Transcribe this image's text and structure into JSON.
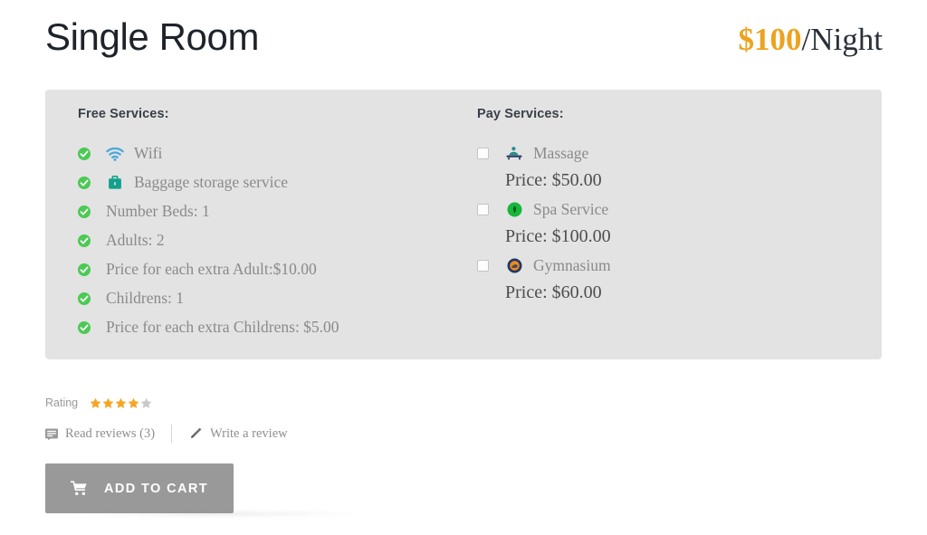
{
  "header": {
    "room_title": "Single Room",
    "price_amount": "$100",
    "price_unit": "/Night"
  },
  "panel": {
    "free_heading": "Free Services:",
    "pay_heading": "Pay Services:",
    "free_services": [
      {
        "label": "Wifi",
        "icon": "wifi-icon",
        "check": "check-circle-icon"
      },
      {
        "label": "Baggage storage service",
        "icon": "briefcase-icon",
        "check": "check-circle-icon"
      },
      {
        "label": "Number Beds: 1",
        "icon": null,
        "check": "check-circle-icon"
      },
      {
        "label": "Adults: 2",
        "icon": null,
        "check": "check-circle-icon"
      },
      {
        "label": "Price for each extra Adult:$10.00",
        "icon": null,
        "check": "check-circle-icon"
      },
      {
        "label": "Childrens: 1",
        "icon": null,
        "check": "check-circle-icon"
      },
      {
        "label": "Price for each extra Childrens: $5.00",
        "icon": null,
        "check": "check-circle-icon"
      }
    ],
    "pay_services": [
      {
        "label": "Massage",
        "icon": "massage-icon",
        "price": "Price: $50.00",
        "checked": false
      },
      {
        "label": "Spa Service",
        "icon": "spa-icon",
        "price": "Price: $100.00",
        "checked": false
      },
      {
        "label": "Gymnasium",
        "icon": "gym-icon",
        "price": "Price: $60.00",
        "checked": false
      }
    ]
  },
  "rating": {
    "label": "Rating",
    "stars_filled": 4,
    "stars_total": 5,
    "read_reviews_label": "Read reviews (3)",
    "write_review_label": "Write a review"
  },
  "actions": {
    "add_to_cart_label": "ADD TO CART"
  },
  "colors": {
    "price_accent": "#eda320",
    "panel_bg": "#e3e3e3",
    "check_green": "#4cc955",
    "star_filled": "#f5a623",
    "star_empty": "#c9c9c9",
    "button_bg": "#999999",
    "wifi_blue": "#4aa8dd",
    "briefcase_teal": "#12a08c",
    "spa_green": "#18b63a",
    "gym_navy": "#1f3864",
    "gym_orange": "#f08a1e"
  }
}
